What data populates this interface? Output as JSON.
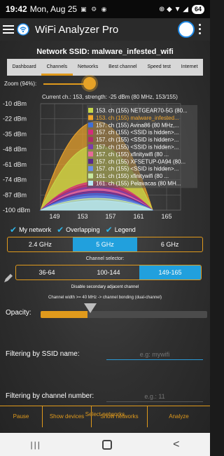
{
  "status_bar": {
    "time": "19:42",
    "date": "Mon, Aug 25",
    "status_icons": "▣ ⚙ ◉",
    "right_icons": "⊕ ◆ ▼ ◢",
    "battery": "64"
  },
  "app": {
    "title": "WiFi Analyzer Pro"
  },
  "ssid_header": "Network SSID: malware_infested_wifi",
  "tabs": [
    {
      "label": "Dashboard"
    },
    {
      "label": "Channels",
      "active": true
    },
    {
      "label": "Networks"
    },
    {
      "label": "Best channel"
    },
    {
      "label": "Speed test"
    },
    {
      "label": "Internet"
    }
  ],
  "zoom": {
    "label": "Zoom (94%):",
    "percent": 94
  },
  "chart_data": {
    "type": "area",
    "current_label": "Current ch.: 153, strength: -25 dBm (80 MHz, 153/155)",
    "y_ticks": [
      "-10 dBm",
      "-22 dBm",
      "-35 dBm",
      "-48 dBm",
      "-61 dBm",
      "-74 dBm",
      "-87 dBm",
      "-100 dBm"
    ],
    "ylim": [
      -100,
      -10
    ],
    "x_ticks": [
      "149",
      "153",
      "157",
      "161",
      "165"
    ],
    "xlim": [
      147,
      167
    ],
    "series": [
      {
        "name": "153. ch (155) NETGEAR70-5G (80...",
        "color": "#c6d84a",
        "start": 147,
        "end": 163,
        "peak": -45
      },
      {
        "name": "153. ch (155) malware_infested...",
        "color": "#f0a52a",
        "start": 147,
        "end": 163,
        "peak": -25
      },
      {
        "name": "157. ch (155) Avina86 (80 MHz,...",
        "color": "#3e6fd8",
        "start": 147,
        "end": 163,
        "peak": -86
      },
      {
        "name": "157. ch (155) <SSID is hidden>...",
        "color": "#d62a7c",
        "start": 147,
        "end": 163,
        "peak": -76
      },
      {
        "name": "157. ch (155) <SSID is hidden>...",
        "color": "#b02a6c",
        "start": 147,
        "end": 163,
        "peak": -78
      },
      {
        "name": "157. ch (155) <SSID is hidden>...",
        "color": "#7b3fa8",
        "start": 147,
        "end": 163,
        "peak": -80
      },
      {
        "name": "157. ch (155) xfinitywifi (80 ...",
        "color": "#e86a9a",
        "start": 147,
        "end": 163,
        "peak": -82
      },
      {
        "name": "157. ch (155) XFSETUP-0A94 (80...",
        "color": "#5a2a8a",
        "start": 147,
        "end": 163,
        "peak": -84
      },
      {
        "name": "157. ch (155) <SSID is hidden>...",
        "color": "#6a8fe8",
        "start": 147,
        "end": 163,
        "peak": -88
      },
      {
        "name": "161. ch (155) xfinitywifi (80 ...",
        "color": "#c8e8a0",
        "start": 147,
        "end": 163,
        "peak": -90
      },
      {
        "name": "161. ch (155) Pelavacas (80 MH...",
        "color": "#b6e6f2",
        "start": 147,
        "end": 163,
        "peak": -92
      }
    ]
  },
  "checkboxes": [
    {
      "label": "My network",
      "checked": true
    },
    {
      "label": "Overlapping",
      "checked": true
    },
    {
      "label": "Legend",
      "checked": true
    }
  ],
  "bands": [
    {
      "label": "2.4 GHz"
    },
    {
      "label": "5 GHz",
      "active": true
    },
    {
      "label": "6 GHz"
    }
  ],
  "channel_selector": {
    "label": "Channel selector:",
    "options": [
      {
        "label": "36-64"
      },
      {
        "label": "100-144"
      },
      {
        "label": "149-165",
        "active": true
      }
    ]
  },
  "disable_secondary": "Disable secondary adjacent channel",
  "channel_width_note": "Channel width >= 40 MHz -> channel bonding (dual-channel)",
  "opacity": {
    "label": "Opacity:",
    "percent": 28
  },
  "filter_ssid": {
    "label": "Filtering by SSID name:",
    "placeholder": "e.g: mywifi"
  },
  "filter_channel": {
    "label": "Filtering by channel number:",
    "placeholder": "e.g.: 11"
  },
  "select_networks": "Select networks",
  "bottom_buttons": [
    "Pause",
    "Show devices",
    "Show networks",
    "Analyze"
  ],
  "nav": {
    "recent": "|||",
    "back": "<"
  }
}
